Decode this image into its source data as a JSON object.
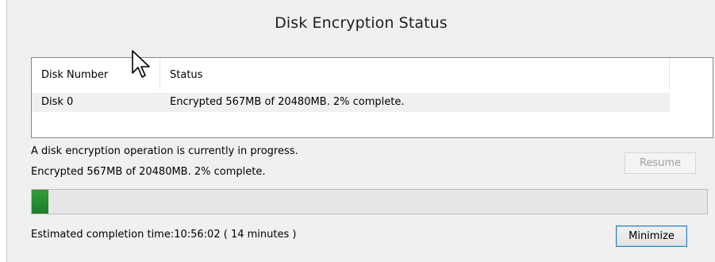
{
  "window": {
    "title": "Disk Encryption Status"
  },
  "table": {
    "columns": [
      "Disk Number",
      "Status"
    ],
    "rows": [
      {
        "disk": "Disk 0",
        "status": "Encrypted 567MB of 20480MB. 2% complete."
      }
    ]
  },
  "status": {
    "line1": "A disk encryption operation is currently in progress.",
    "line2": "Encrypted 567MB of 20480MB. 2% complete.",
    "eta": "Estimated completion time:10:56:02 ( 14 minutes )"
  },
  "progress": {
    "fraction": 0.025,
    "color": "#1e7f2a"
  },
  "buttons": {
    "resume": "Resume",
    "minimize": "Minimize"
  },
  "icons": {
    "cursor": "mouse-pointer-icon"
  }
}
